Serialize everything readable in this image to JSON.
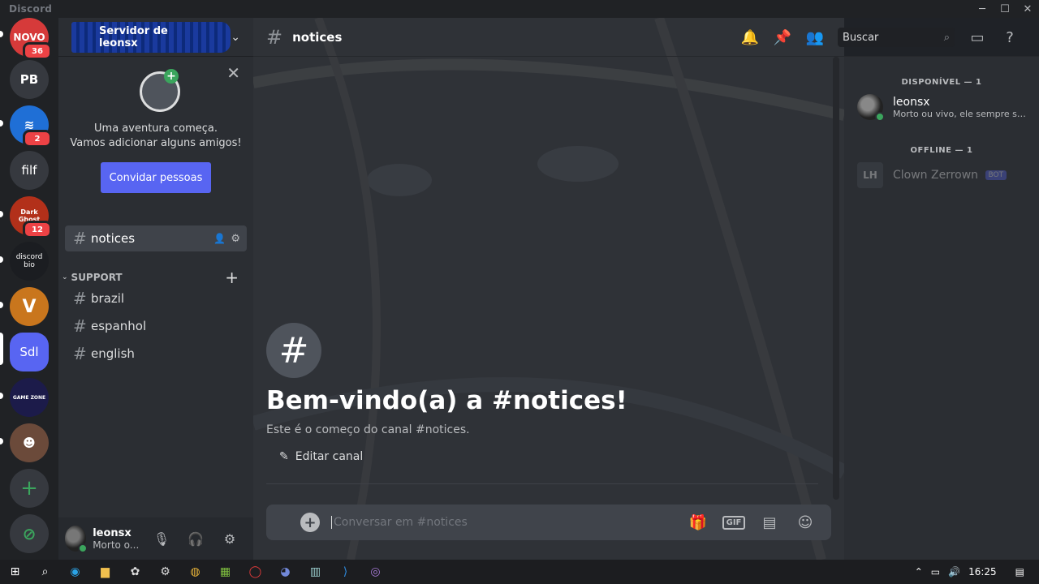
{
  "app": {
    "title": "Discord"
  },
  "window_controls": {
    "minimize": "─",
    "maximize": "☐",
    "close": "✕"
  },
  "servers": [
    {
      "label": "NOVO",
      "badge": "36",
      "bg": "#d63a3a"
    },
    {
      "label": "PB",
      "badge": "",
      "bg": "#36393f"
    },
    {
      "label": "",
      "badge": "2",
      "bg": "#1f6fd6"
    },
    {
      "label": "filf",
      "badge": "",
      "bg": "#36393f"
    },
    {
      "label": "Dark Ghost",
      "badge": "12",
      "bg": "#b2301a"
    },
    {
      "label": "discord bio",
      "badge": "",
      "bg": "#1b1d21"
    },
    {
      "label": "V",
      "badge": "",
      "bg": "#c9761d"
    },
    {
      "label": "Sdl",
      "badge": "",
      "bg": "#5865f2"
    },
    {
      "label": "GAME ZONE",
      "badge": "",
      "bg": "#1c1b4a"
    },
    {
      "label": "",
      "badge": "",
      "bg": "#6b4a3a"
    }
  ],
  "sidebar": {
    "server_name": "Servidor de leonsx",
    "invite": {
      "line1": "Uma aventura começa.",
      "line2": "Vamos adicionar alguns amigos!",
      "button": "Convidar pessoas"
    },
    "active_channel": "notices",
    "category": "SUPPORT",
    "channels": [
      "brazil",
      "espanhol",
      "english"
    ]
  },
  "user": {
    "name": "leonsx",
    "status": "Morto o..."
  },
  "header": {
    "channel": "notices",
    "search_placeholder": "Buscar"
  },
  "welcome": {
    "title": "Bem-vindo(a) a #notices!",
    "subtitle": "Este é o começo do canal #notices.",
    "edit_label": "Editar canal"
  },
  "composer": {
    "placeholder": "Conversar em #notices",
    "gif_label": "GIF"
  },
  "members": {
    "online_header": "DISPONÍVEL — 1",
    "offline_header": "OFFLINE — 1",
    "online": [
      {
        "name": "leonsx",
        "status": "Morto ou vivo, ele sempre será..."
      }
    ],
    "offline": [
      {
        "name": "Clown Zerrown",
        "tag": "BOT"
      }
    ]
  },
  "taskbar": {
    "time": "16:25"
  }
}
